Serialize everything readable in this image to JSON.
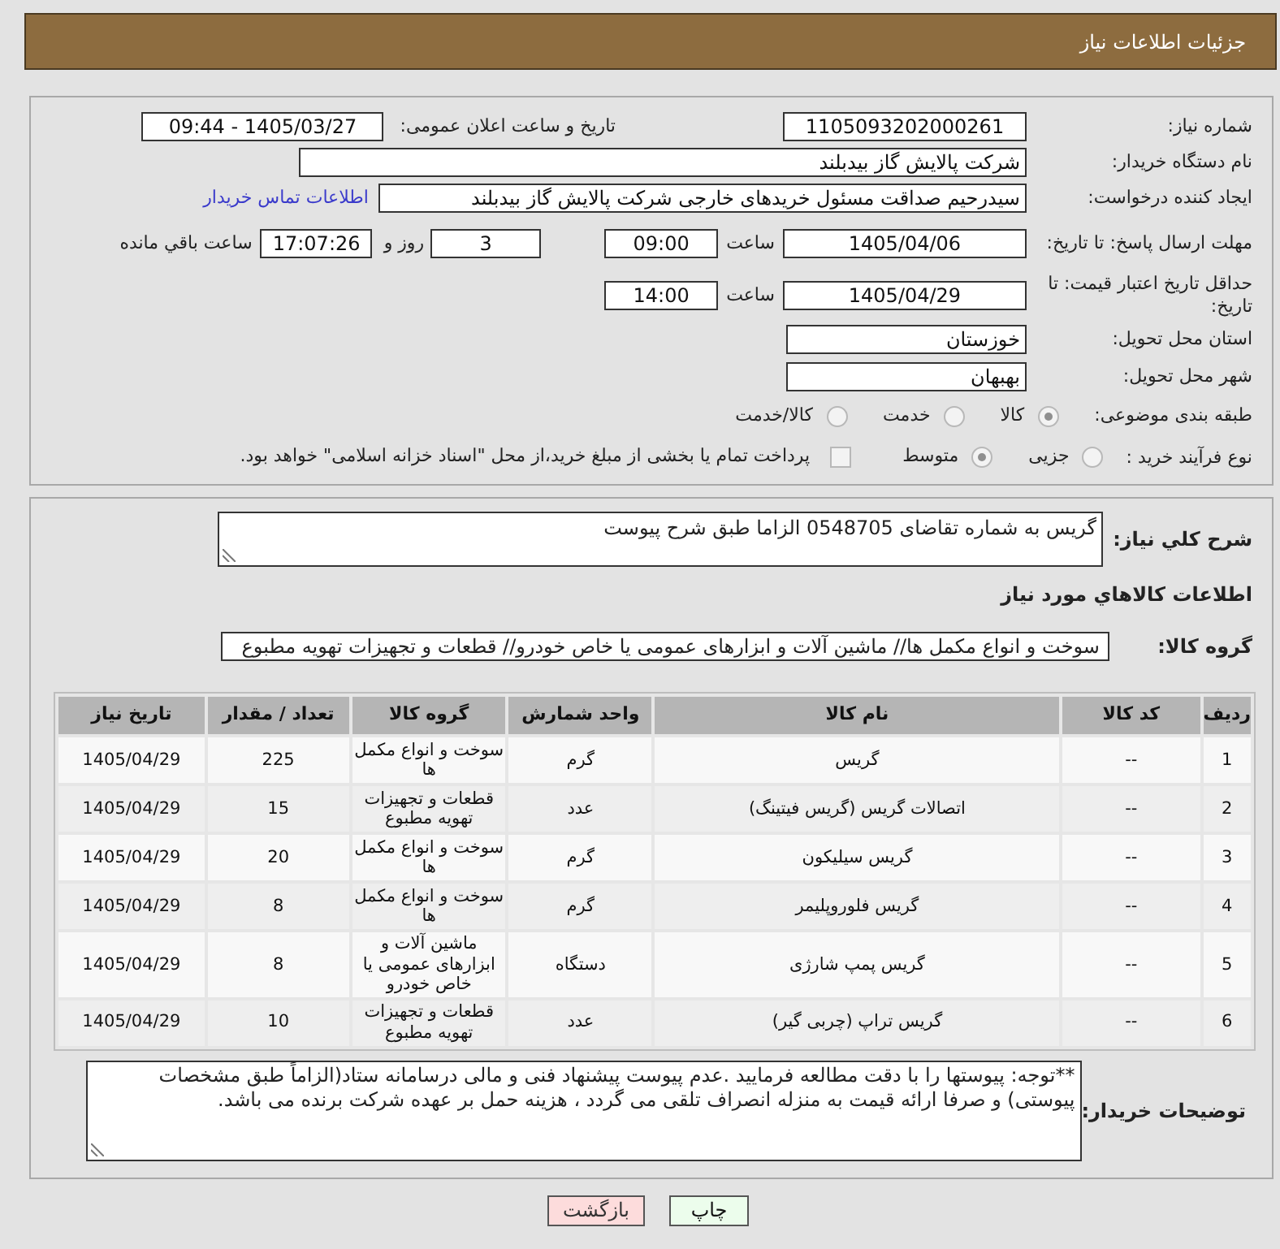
{
  "header": {
    "title": "جزئیات اطلاعات نیاز"
  },
  "need": {
    "number": {
      "label": "شماره نیاز:",
      "value": "1105093202000261"
    },
    "announce": {
      "label": "تاریخ و ساعت اعلان عمومی:",
      "value": "1405/03/27 - 09:44"
    },
    "buyer": {
      "label": "نام دستگاه خریدار:",
      "value": "شرکت پالایش گاز بیدبلند"
    },
    "requester": {
      "label": "ایجاد کننده درخواست:",
      "value": "سیدرحیم صداقت مسئول خریدهای خارجی شرکت پالایش گاز بیدبلند",
      "contact_link": "اطلاعات تماس خریدار"
    },
    "reply_deadline": {
      "label": "مهلت ارسال پاسخ: تا تاریخ:",
      "date": "1405/04/06",
      "time_label": "ساعت",
      "time": "09:00",
      "days": "3",
      "days_label": "روز و",
      "remaining": "17:07:26",
      "remaining_label": "ساعت باقي مانده"
    },
    "price_validity": {
      "label": "حداقل تاریخ اعتبار قیمت: تا تاریخ:",
      "date": "1405/04/29",
      "time_label": "ساعت",
      "time": "14:00"
    },
    "province": {
      "label": "استان محل تحویل:",
      "value": "خوزستان"
    },
    "city": {
      "label": "شهر محل تحویل:",
      "value": "بهبهان"
    },
    "category": {
      "label": "طبقه بندی موضوعی:",
      "options": [
        {
          "label": "کالا",
          "selected": true
        },
        {
          "label": "خدمت",
          "selected": false
        },
        {
          "label": "کالا/خدمت",
          "selected": false
        }
      ]
    },
    "process": {
      "label": "نوع فرآیند خرید :",
      "options": [
        {
          "label": "جزیی",
          "selected": false
        },
        {
          "label": "متوسط",
          "selected": true
        }
      ],
      "treasury": {
        "label": "پرداخت تمام یا بخشی از مبلغ خرید،از محل \"اسناد خزانه اسلامی\" خواهد بود.",
        "checked": false
      }
    }
  },
  "summary": {
    "label": "شرح کلي نیاز:",
    "value": "گریس به شماره تقاضای 0548705 الزاما طبق شرح پیوست"
  },
  "goods": {
    "title": "اطلاعات کالاهاي مورد نياز",
    "group_label": "گروه کالا:",
    "group_value": "سوخت و انواع مکمل ها//  ماشین آلات و ابزارهای عمومی یا خاص خودرو//  قطعات و تجهیزات تهویه مطبوع",
    "table": {
      "columns": [
        "ردیف",
        "کد کالا",
        "نام کالا",
        "واحد شمارش",
        "گروه کالا",
        "تعداد / مقدار",
        "تاریخ نیاز"
      ],
      "rows": [
        [
          "1",
          "--",
          "گریس",
          "گرم",
          "سوخت و انواع مکمل ها",
          "225",
          "1405/04/29"
        ],
        [
          "2",
          "--",
          "اتصالات گریس (گریس فیتینگ)",
          "عدد",
          "قطعات و تجهیزات تهویه مطبوع",
          "15",
          "1405/04/29"
        ],
        [
          "3",
          "--",
          "گریس سیلیکون",
          "گرم",
          "سوخت و انواع مکمل ها",
          "20",
          "1405/04/29"
        ],
        [
          "4",
          "--",
          "گریس فلوروپلیمر",
          "گرم",
          "سوخت و انواع مکمل ها",
          "8",
          "1405/04/29"
        ],
        [
          "5",
          "--",
          "گریس پمپ شارژی",
          "دستگاه",
          "ماشین آلات و ابزارهای عمومی یا خاص خودرو",
          "8",
          "1405/04/29"
        ],
        [
          "6",
          "--",
          "گریس تراپ (چربی گیر)",
          "عدد",
          "قطعات و تجهیزات تهویه مطبوع",
          "10",
          "1405/04/29"
        ]
      ]
    }
  },
  "buyer_notes": {
    "label": "توضیحات خریدار:",
    "value": "**توجه: پیوستها را با دقت مطالعه فرمایید .عدم پیوست پیشنهاد فنی و مالی درسامانه ستاد(الزاماً طبق مشخصات پیوستی) و صرفا ارائه قیمت به منزله انصراف تلقی می گردد ، هزینه حمل بر عهده شرکت برنده می باشد."
  },
  "buttons": [
    {
      "kind": "print",
      "label": "چاپ"
    },
    {
      "kind": "back",
      "label": "بازگشت"
    }
  ]
}
